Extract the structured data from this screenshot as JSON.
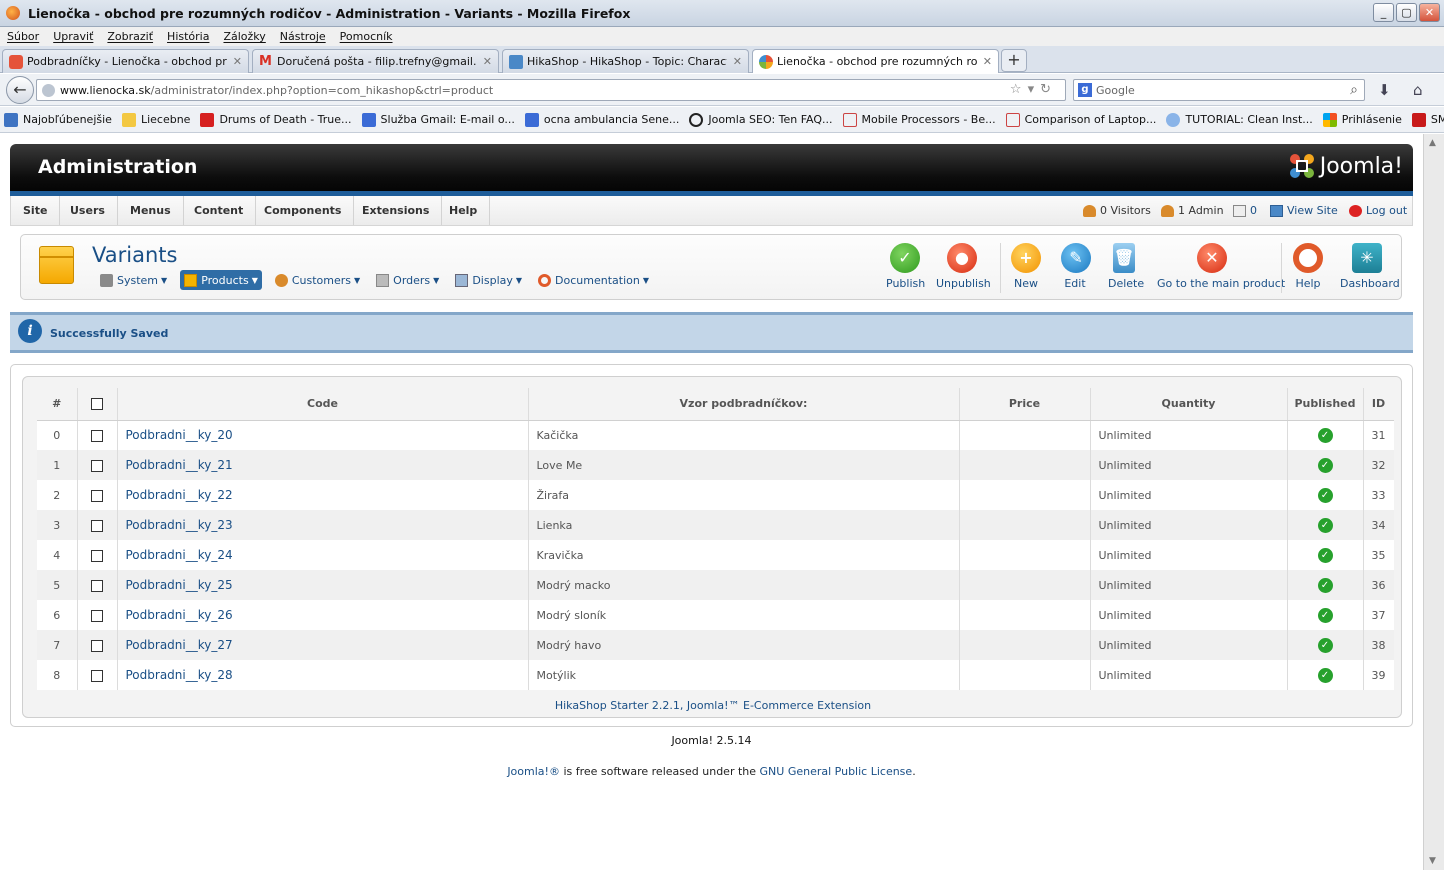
{
  "window": {
    "title": "Lienočka - obchod pre rozumných rodičov - Administration - Variants - Mozilla Firefox"
  },
  "menubar": [
    "Súbor",
    "Upraviť",
    "Zobraziť",
    "História",
    "Záložky",
    "Nástroje",
    "Pomocník"
  ],
  "tabs": [
    {
      "label": "Podbradníčky - Lienočka - obchod pre roz..."
    },
    {
      "label": "Doručená pošta - filip.trefny@gmail.com ..."
    },
    {
      "label": "HikaShop - HikaShop - Topic: Characteris..."
    },
    {
      "label": "Lienočka - obchod pre rozumných rodičov..."
    }
  ],
  "address": {
    "host": "www.lienocka.sk",
    "path": "/administrator/index.php?option=com_hikashop&ctrl=product"
  },
  "search": {
    "placeholder": "Google"
  },
  "bookmarks": [
    "Najobľúbenejšie",
    "Liecebne",
    "Drums of Death - True...",
    "Služba Gmail: E-mail o...",
    "ocna ambulancia Sene...",
    "Joomla SEO: Ten FAQ...",
    "Mobile Processors - Be...",
    "Comparison of Laptop...",
    "TUTORIAL: Clean Inst...",
    "Prihlásenie",
    "SME.sk | denník SME -..."
  ],
  "colors": {
    "accent": "#1a4f86",
    "header_border": "#1e5d9a",
    "published": "#27a12d"
  },
  "admin": {
    "title": "Administration",
    "logo": "Joomla!",
    "nav": [
      "Site",
      "Users",
      "Menus",
      "Content",
      "Components",
      "Extensions",
      "Help"
    ],
    "status": {
      "visitors": "0 Visitors",
      "admins": "1 Admin",
      "messages": "0",
      "view_site": "View Site",
      "logout": "Log out"
    }
  },
  "page": {
    "title": "Variants",
    "submenu": [
      "System",
      "Products",
      "Customers",
      "Orders",
      "Display",
      "Documentation"
    ],
    "toolbar": {
      "publish": "Publish",
      "unpublish": "Unpublish",
      "new": "New",
      "edit": "Edit",
      "delete": "Delete",
      "main_product": "Go to the main product",
      "help": "Help",
      "dashboard": "Dashboard"
    }
  },
  "message": "Successfully Saved",
  "table": {
    "headers": {
      "num": "#",
      "code": "Code",
      "vzor": "Vzor podbradníčkov:",
      "price": "Price",
      "quantity": "Quantity",
      "published": "Published",
      "id": "ID"
    },
    "rows": [
      {
        "num": "0",
        "code": "Podbradni__ky_20",
        "vzor": "Kačička",
        "price": "",
        "quantity": "Unlimited",
        "id": "31"
      },
      {
        "num": "1",
        "code": "Podbradni__ky_21",
        "vzor": "Love Me",
        "price": "",
        "quantity": "Unlimited",
        "id": "32"
      },
      {
        "num": "2",
        "code": "Podbradni__ky_22",
        "vzor": "Žirafa",
        "price": "",
        "quantity": "Unlimited",
        "id": "33"
      },
      {
        "num": "3",
        "code": "Podbradni__ky_23",
        "vzor": "Lienka",
        "price": "",
        "quantity": "Unlimited",
        "id": "34"
      },
      {
        "num": "4",
        "code": "Podbradni__ky_24",
        "vzor": "Kravička",
        "price": "",
        "quantity": "Unlimited",
        "id": "35"
      },
      {
        "num": "5",
        "code": "Podbradni__ky_25",
        "vzor": "Modrý macko",
        "price": "",
        "quantity": "Unlimited",
        "id": "36"
      },
      {
        "num": "6",
        "code": "Podbradni__ky_26",
        "vzor": "Modrý sloník",
        "price": "",
        "quantity": "Unlimited",
        "id": "37"
      },
      {
        "num": "7",
        "code": "Podbradni__ky_27",
        "vzor": "Modrý havo",
        "price": "",
        "quantity": "Unlimited",
        "id": "38"
      },
      {
        "num": "8",
        "code": "Podbradni__ky_28",
        "vzor": "Motýlik",
        "price": "",
        "quantity": "Unlimited",
        "id": "39"
      }
    ]
  },
  "footer": {
    "hikashop": "HikaShop Starter 2.2.1, Joomla!™ E-Commerce Extension",
    "joomla_version": "Joomla! 2.5.14",
    "license_prefix": "Joomla!®",
    "license_mid": " is free software released under the ",
    "license_link": "GNU General Public License",
    "license_end": "."
  }
}
